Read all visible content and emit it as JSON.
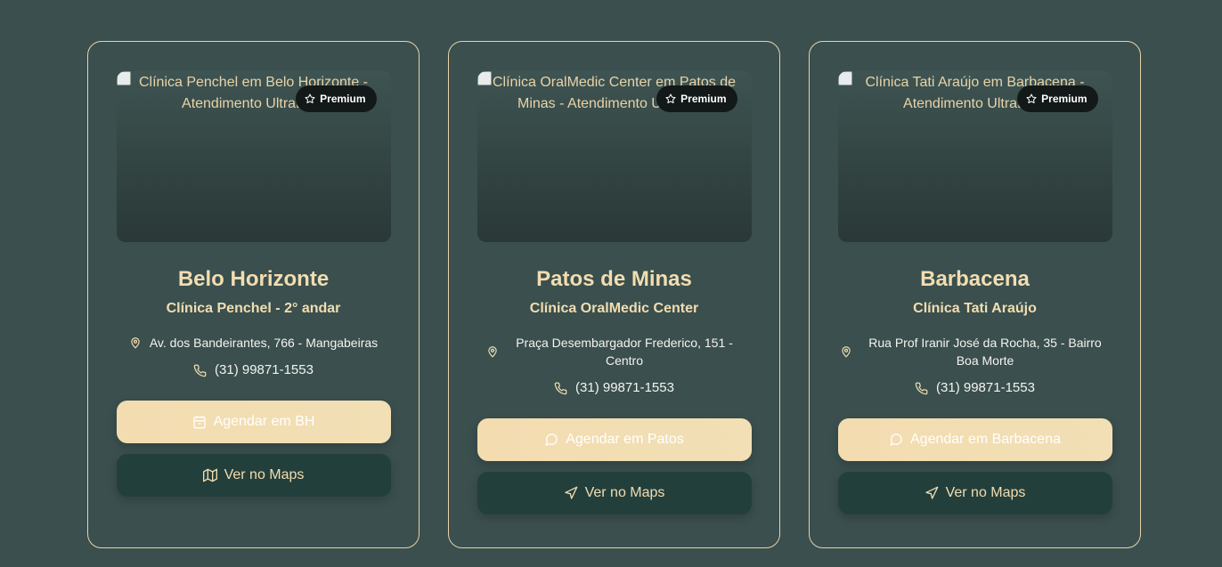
{
  "cards": [
    {
      "image_alt": "Clínica Penchel em Belo Horizonte - Atendimento UltraBem",
      "badge": "Premium",
      "city": "Belo Horizonte",
      "clinic": "Clínica Penchel - 2° andar",
      "address": "Av. dos Bandeirantes, 766 - Mangabeiras",
      "phone": "(31) 99871-1553",
      "primary_button": "Agendar em BH",
      "primary_icon": "calendar-icon",
      "secondary_button": "Ver no Maps",
      "secondary_icon": "map-icon"
    },
    {
      "image_alt": "Clínica OralMedic Center em Patos de Minas - Atendimento UltraBem",
      "badge": "Premium",
      "city": "Patos de Minas",
      "clinic": "Clínica OralMedic Center",
      "address": "Praça Desembargador Frederico, 151 - Centro",
      "phone": "(31) 99871-1553",
      "primary_button": "Agendar em Patos",
      "primary_icon": "chat-icon",
      "secondary_button": "Ver no Maps",
      "secondary_icon": "navigation-icon"
    },
    {
      "image_alt": "Clínica Tati Araújo em Barbacena - Atendimento UltraBem",
      "badge": "Premium",
      "city": "Barbacena",
      "clinic": "Clínica Tati Araújo",
      "address": "Rua Prof Iranir José da Rocha, 35 - Bairro Boa Morte",
      "phone": "(31) 99871-1553",
      "primary_button": "Agendar em Barbacena",
      "primary_icon": "chat-icon",
      "secondary_button": "Ver no Maps",
      "secondary_icon": "navigation-icon"
    }
  ],
  "colors": {
    "background": "#3a4f4e",
    "accent": "#f2ddb0",
    "button_dark": "#233f3c",
    "badge_bg": "#131918"
  }
}
